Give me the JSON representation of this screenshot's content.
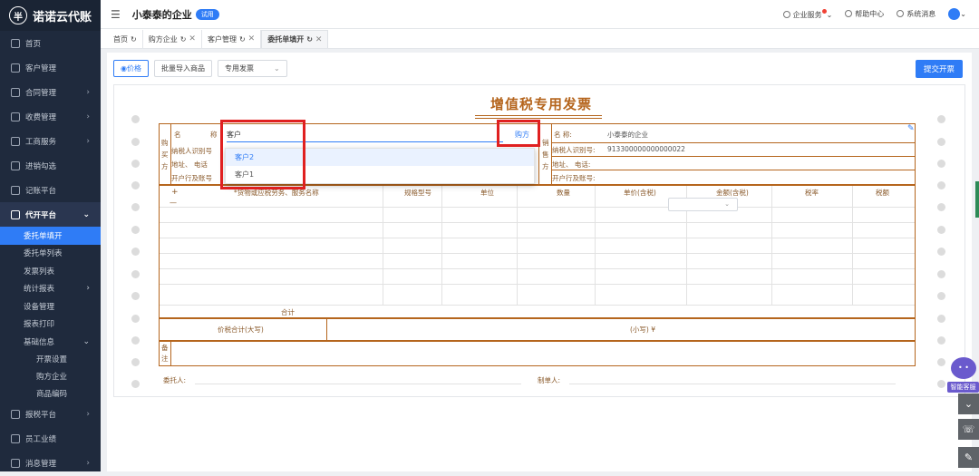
{
  "app": {
    "name": "诺诺云代账",
    "logo_glyph": "半"
  },
  "sidebar": {
    "items": [
      {
        "label": "首页",
        "icon": "home-icon"
      },
      {
        "label": "客户管理",
        "icon": "user-icon"
      },
      {
        "label": "合同管理",
        "icon": "contract-icon",
        "arrow": "›"
      },
      {
        "label": "收费管理",
        "icon": "fee-icon",
        "arrow": "›"
      },
      {
        "label": "工商服务",
        "icon": "business-icon",
        "arrow": "›"
      },
      {
        "label": "进销勾选",
        "icon": "check-icon"
      },
      {
        "label": "记账平台",
        "icon": "cloud-icon"
      }
    ],
    "active_group": {
      "label": "代开平台",
      "arrow": "⌄"
    },
    "sub_items": [
      {
        "label": "委托单填开",
        "selected": true
      },
      {
        "label": "委托单列表"
      },
      {
        "label": "发票列表"
      },
      {
        "label": "统计报表",
        "arrow": "›"
      },
      {
        "label": "设备管理"
      },
      {
        "label": "报表打印"
      },
      {
        "label": "基础信息",
        "arrow": "⌄"
      }
    ],
    "sub_sub_items": [
      {
        "label": "开票设置"
      },
      {
        "label": "购方企业"
      },
      {
        "label": "商品编码"
      }
    ],
    "bottom_items": [
      {
        "label": "报税平台",
        "arrow": "›"
      },
      {
        "label": "员工业绩"
      },
      {
        "label": "消息管理",
        "arrow": "›"
      }
    ]
  },
  "header": {
    "menu_glyph": "☰",
    "company": "小泰泰的企业",
    "trial_badge": "试用",
    "enterprise_service": "企业服务",
    "help": "帮助中心",
    "messages": "系统消息",
    "chevron": "⌄"
  },
  "tabs": [
    {
      "label": "首页",
      "refresh": "↻",
      "close": ""
    },
    {
      "label": "购方企业",
      "refresh": "↻",
      "close": "✕"
    },
    {
      "label": "客户管理",
      "refresh": "↻",
      "close": "✕"
    },
    {
      "label": "委托单填开",
      "refresh": "↻",
      "close": "✕",
      "active": true
    }
  ],
  "toolbar": {
    "price_btn": "价格",
    "batch_import": "批量导入商品",
    "invoice_type": "专用发票",
    "select_arrow": "⌄",
    "submit": "提交开票"
  },
  "invoice": {
    "title": "增值税专用发票",
    "buyer_side_label": "购买方",
    "buyer_chars": [
      "购",
      "买",
      "方"
    ],
    "seller_chars": [
      "销",
      "售",
      "方"
    ],
    "name_label_a": "名",
    "name_label_b": "称",
    "buyer_tax_id_label": "纳税人识别号",
    "buyer_address_label": "地址、  电话",
    "buyer_bank_label": "开户行及账号",
    "customer_input": "客户",
    "buyer_button": "购方",
    "seller_name_label": "名        称:",
    "seller_name": "小泰泰的企业",
    "seller_tax_id_label": "纳税人识别号:",
    "seller_tax_id": "913300000000000022",
    "seller_address_label": "地址、    电话:",
    "seller_bank_label": "开户行及账号:",
    "edit_icon": "✎",
    "add_row": "+",
    "remove_row": "—",
    "columns": [
      "*货物或应税劳务、服务名称",
      "规格型号",
      "单位",
      "数量",
      "单价(含税)",
      "金额(含税)",
      "税率",
      "税额"
    ],
    "tax_rate_arrow": "⌄",
    "total_label": "合计",
    "total_in_words_label": "价税合计(大写)",
    "total_small_label": "(小写)  ¥",
    "remarks_chars": [
      "备",
      "注"
    ],
    "entrusted_label": "委托人:",
    "issuer_label": "制单人:"
  },
  "dropdown": {
    "options": [
      "客户2",
      "客户1"
    ]
  },
  "assistant": {
    "label": "智能客服",
    "glyph": "• •"
  },
  "side_buttons": [
    {
      "glyph": "⌄"
    },
    {
      "glyph": "☏"
    },
    {
      "glyph": "✎"
    }
  ]
}
